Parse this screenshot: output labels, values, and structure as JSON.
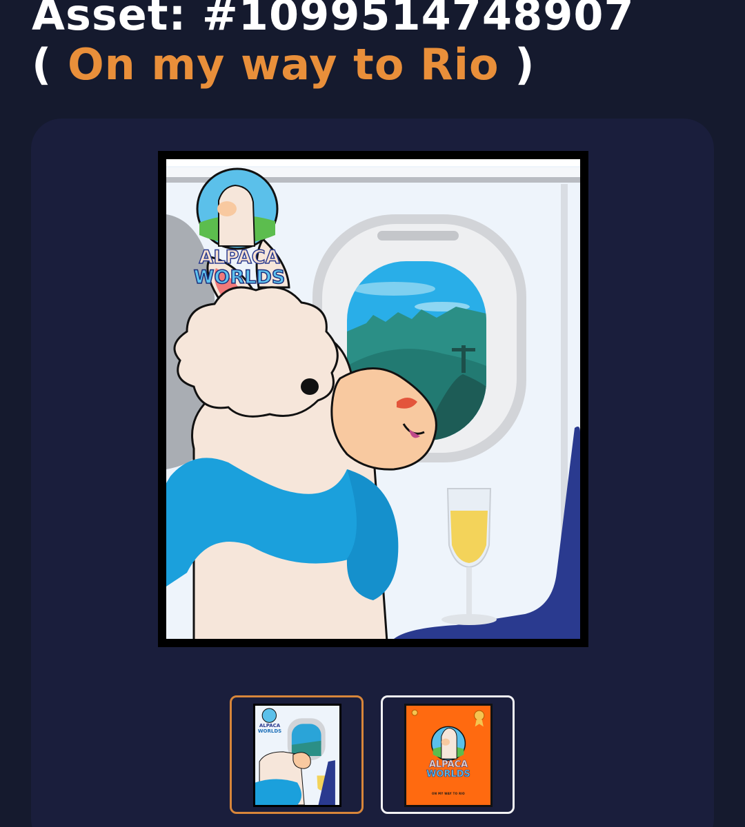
{
  "header": {
    "asset_label": "Asset: #1099514748907",
    "open_paren": "(",
    "asset_name": "On my way to Rio",
    "close_paren": ")"
  },
  "artwork": {
    "logo_line1": "ALPACA",
    "logo_line2": "WORLDS"
  },
  "thumbnails": [
    {
      "logo_line1": "ALPACA",
      "logo_line2": "WORLDS",
      "selected": true
    },
    {
      "logo_line1": "ALPACA",
      "logo_line2": "WORLDS",
      "caption": "On my way to Rio",
      "selected": false
    }
  ],
  "colors": {
    "background": "#151a2e",
    "card": "#1a1e3c",
    "accent": "#e98f3a",
    "selected_border": "#d8863a",
    "unselected_border": "#f2f2f4",
    "thumb2_bg": "#ff6a10"
  }
}
